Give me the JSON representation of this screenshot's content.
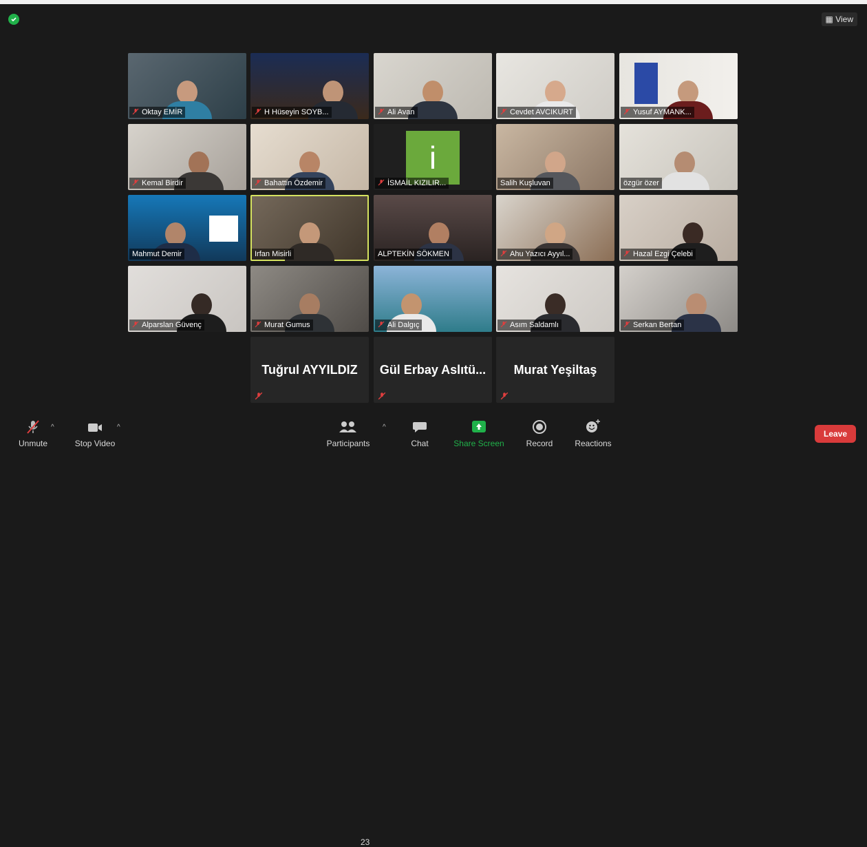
{
  "app": {
    "view_label": "View",
    "brand_colors": {
      "leave": "#d93b3b",
      "share_green": "#20b14a",
      "active_speaker": "#d6e360"
    }
  },
  "participants": [
    {
      "name": "Oktay EMİR",
      "muted": true
    },
    {
      "name": "H Hüseyin SOYB...",
      "muted": true
    },
    {
      "name": "Ali Avan",
      "muted": true
    },
    {
      "name": "Cevdet AVCIKURT",
      "muted": true
    },
    {
      "name": "Yusuf AYMANK...",
      "muted": true
    },
    {
      "name": "Kemal Birdir",
      "muted": true
    },
    {
      "name": "Bahattin Özdemir",
      "muted": true
    },
    {
      "name": "İSMAİL KIZILIR...",
      "muted": true
    },
    {
      "name": "Salih Kuşluvan",
      "muted": false
    },
    {
      "name": "özgür özer",
      "muted": false
    },
    {
      "name": "Mahmut Demir",
      "muted": false
    },
    {
      "name": "Irfan Misirli",
      "muted": false
    },
    {
      "name": "ALPTEKİN SÖKMEN",
      "muted": false
    },
    {
      "name": "Ahu Yazıcı Ayyıl...",
      "muted": true
    },
    {
      "name": "Hazal Ezgi Çelebi",
      "muted": true
    },
    {
      "name": "Alparslan Güvenç",
      "muted": true
    },
    {
      "name": "Murat Gumus",
      "muted": true
    },
    {
      "name": "Ali Dalgıç",
      "muted": true
    },
    {
      "name": "Asım Saldamlı",
      "muted": true
    },
    {
      "name": "Serkan Bertan",
      "muted": true
    }
  ],
  "avatar_letter": "i",
  "text_tiles": [
    {
      "name": "Tuğrul AYYILDIZ"
    },
    {
      "name": "Gül Erbay Aslıtü..."
    },
    {
      "name": "Murat Yeşiltaş"
    }
  ],
  "toolbar": {
    "unmute": "Unmute",
    "stop_video": "Stop Video",
    "participants": "Participants",
    "participant_count": "23",
    "chat": "Chat",
    "share_screen": "Share Screen",
    "record": "Record",
    "reactions": "Reactions",
    "leave": "Leave"
  }
}
